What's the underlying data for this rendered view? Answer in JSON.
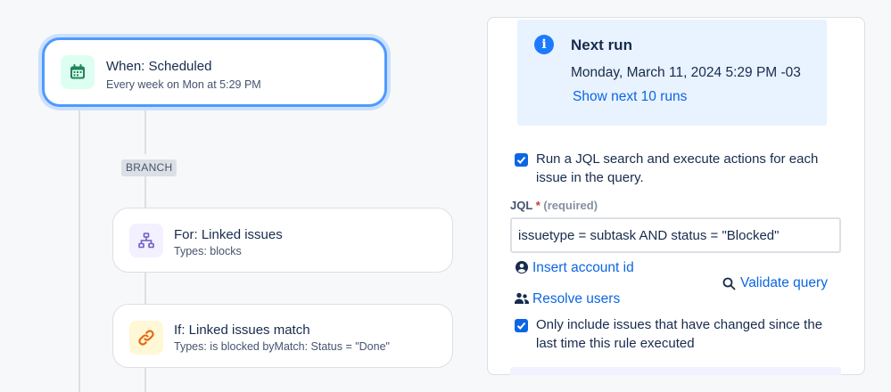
{
  "flow": {
    "trigger": {
      "title": "When: Scheduled",
      "subtitle": "Every week on Mon at 5:29 PM",
      "icon": "calendar-icon",
      "icon_bg": "#dcfff1",
      "icon_color": "#1f845a"
    },
    "branch_label": "BRANCH",
    "branch_step": {
      "title": "For: Linked issues",
      "subtitle": "Types: blocks",
      "icon": "hierarchy-icon",
      "icon_bg": "#f3f0ff",
      "icon_color": "#6e5dc6"
    },
    "condition_step": {
      "title": "If: Linked issues match",
      "subtitle": "Types: is blocked byMatch: Status = \"Done\"",
      "icon": "link-icon",
      "icon_bg": "#fff7d6",
      "icon_color": "#e56910"
    }
  },
  "panel": {
    "next_run": {
      "title": "Next run",
      "date": "Monday, March 11, 2024 5:29 PM -03",
      "link": "Show next 10 runs"
    },
    "run_jql_checkbox": {
      "checked": true,
      "label_line1": "Run a JQL search and execute actions for each",
      "label_line2": "issue in the query."
    },
    "jql": {
      "label": "JQL",
      "required_marker": "*",
      "required_text": "(required)",
      "value": "issuetype = subtask AND status = \"Blocked\""
    },
    "insert_account_link": "Insert account id",
    "resolve_users_link": "Resolve users",
    "validate_query_link": "Validate query",
    "only_changed_checkbox": {
      "checked": true,
      "label_line1": "Only include issues that have changed since the",
      "label_line2": "last time this rule executed"
    }
  },
  "colors": {
    "accent": "#0c66e4",
    "selected_border": "#4c9aff",
    "info_bg": "#e9f2ff"
  }
}
